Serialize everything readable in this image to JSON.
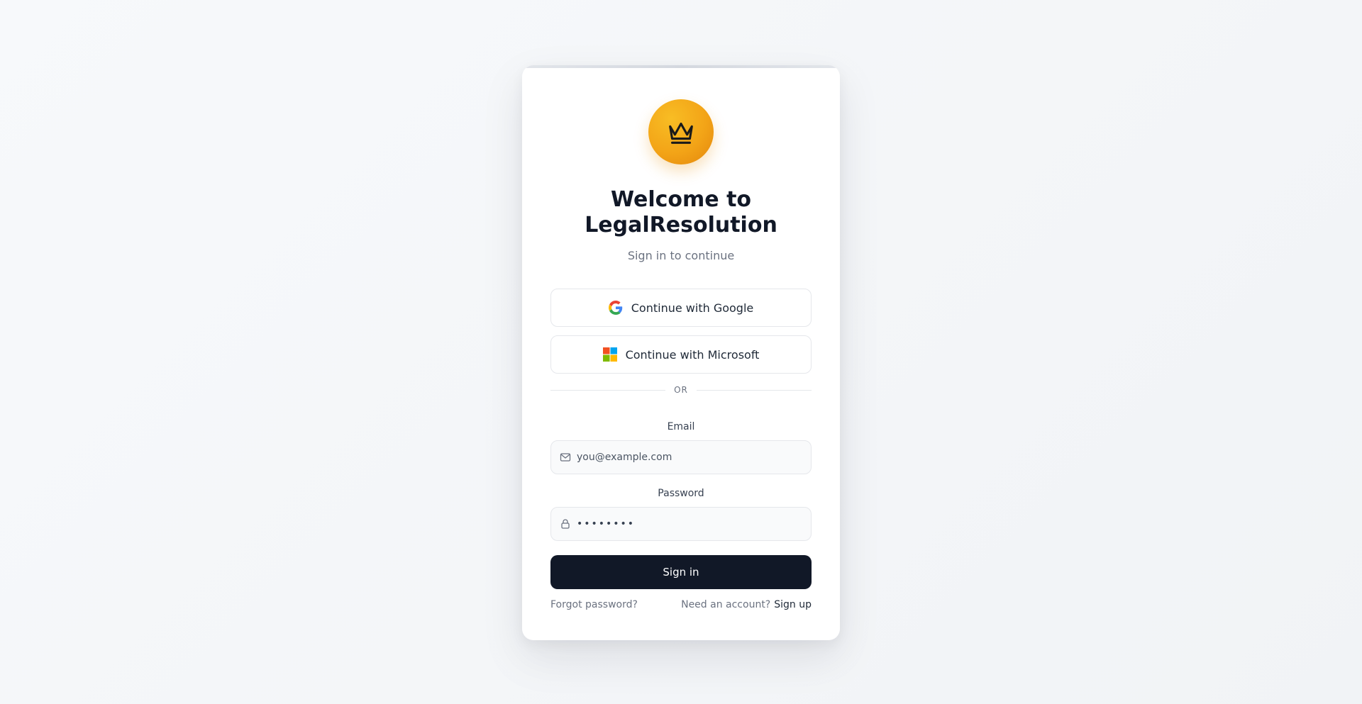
{
  "brand": {
    "logo_icon": "crown-icon",
    "accent_color": "#f3a417"
  },
  "header": {
    "title": "Welcome to LegalResolution",
    "subtitle": "Sign in to continue"
  },
  "oauth": {
    "google_label": "Continue with Google",
    "google_icon": "google-icon",
    "microsoft_label": "Continue with Microsoft",
    "microsoft_icon": "microsoft-icon"
  },
  "divider": {
    "label": "OR"
  },
  "form": {
    "email_label": "Email",
    "email_placeholder": "you@example.com",
    "email_icon": "mail-icon",
    "password_label": "Password",
    "password_value": "••••••••",
    "password_icon": "lock-icon",
    "submit_label": "Sign in",
    "submit_color": "#111827"
  },
  "footer": {
    "forgot_label": "Forgot password?",
    "need_account_text": "Need an account?",
    "signup_label": "Sign up"
  }
}
